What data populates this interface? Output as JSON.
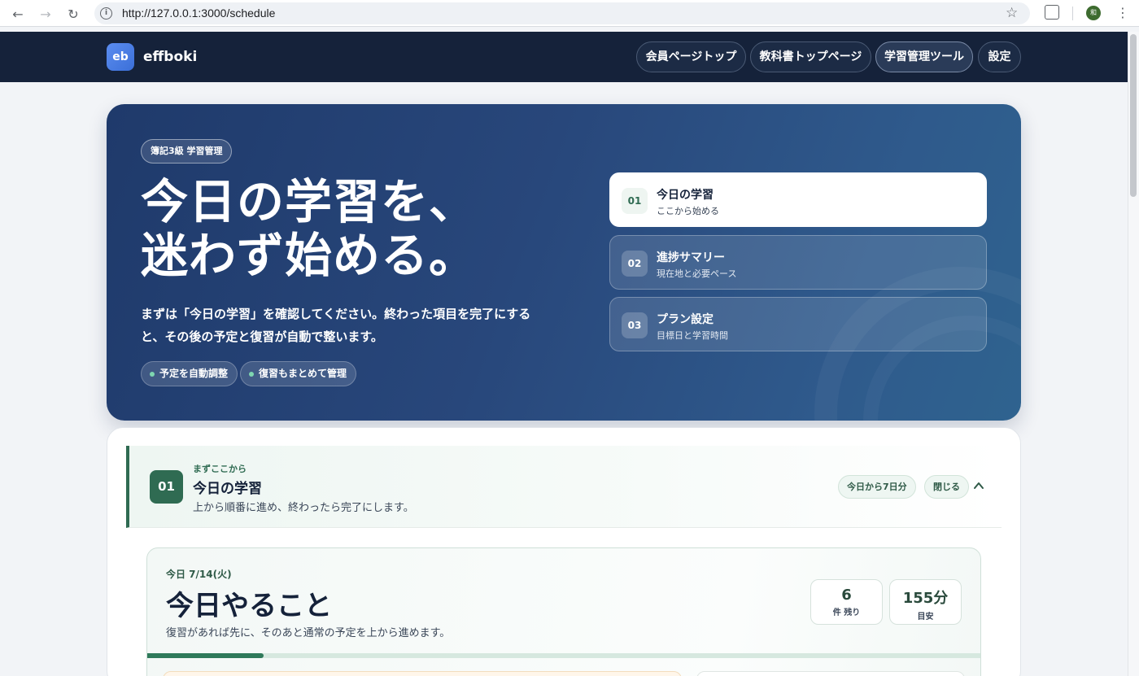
{
  "browser": {
    "url": "http://127.0.0.1:3000/schedule",
    "avatar_initial": "和"
  },
  "header": {
    "logo_badge": "eb",
    "brand": "effboki",
    "nav": [
      {
        "label": "会員ページトップ",
        "active": false
      },
      {
        "label": "教科書トップページ",
        "active": false
      },
      {
        "label": "学習管理ツール",
        "active": true
      },
      {
        "label": "設定",
        "active": false
      }
    ]
  },
  "hero": {
    "tag": "簿記3級 学習管理",
    "title_line1": "今日の学習を、",
    "title_line2": "迷わず始める。",
    "description": "まずは「今日の学習」を確認してください。終わった項目を完了にすると、その後の予定と復習が自動で整います。",
    "chips": [
      "予定を自動調整",
      "復習もまとめて管理"
    ],
    "steps": [
      {
        "num": "01",
        "title": "今日の学習",
        "sub": "ここから始める",
        "active": true
      },
      {
        "num": "02",
        "title": "進捗サマリー",
        "sub": "現在地と必要ペース",
        "active": false
      },
      {
        "num": "03",
        "title": "プラン設定",
        "sub": "目標日と学習時間",
        "active": false
      }
    ]
  },
  "section": {
    "badge": "01",
    "eyebrow": "まずここから",
    "title": "今日の学習",
    "description": "上から順番に進め、終わったら完了にします。",
    "range_pill": "今日から7日分",
    "close_label": "閉じる"
  },
  "today": {
    "date": "今日 7/14(火)",
    "title": "今日やること",
    "description": "復習があれば先に、そのあと通常の予定を上から進めます。",
    "stats": [
      {
        "value": "6",
        "label": "件 残り"
      },
      {
        "value": "155分",
        "label": "目安"
      }
    ],
    "progress_fraction": 0.14
  },
  "colors": {
    "header_bg": "#15223a",
    "accent_green": "#2f6b52",
    "hero_bg": "#28477b"
  }
}
